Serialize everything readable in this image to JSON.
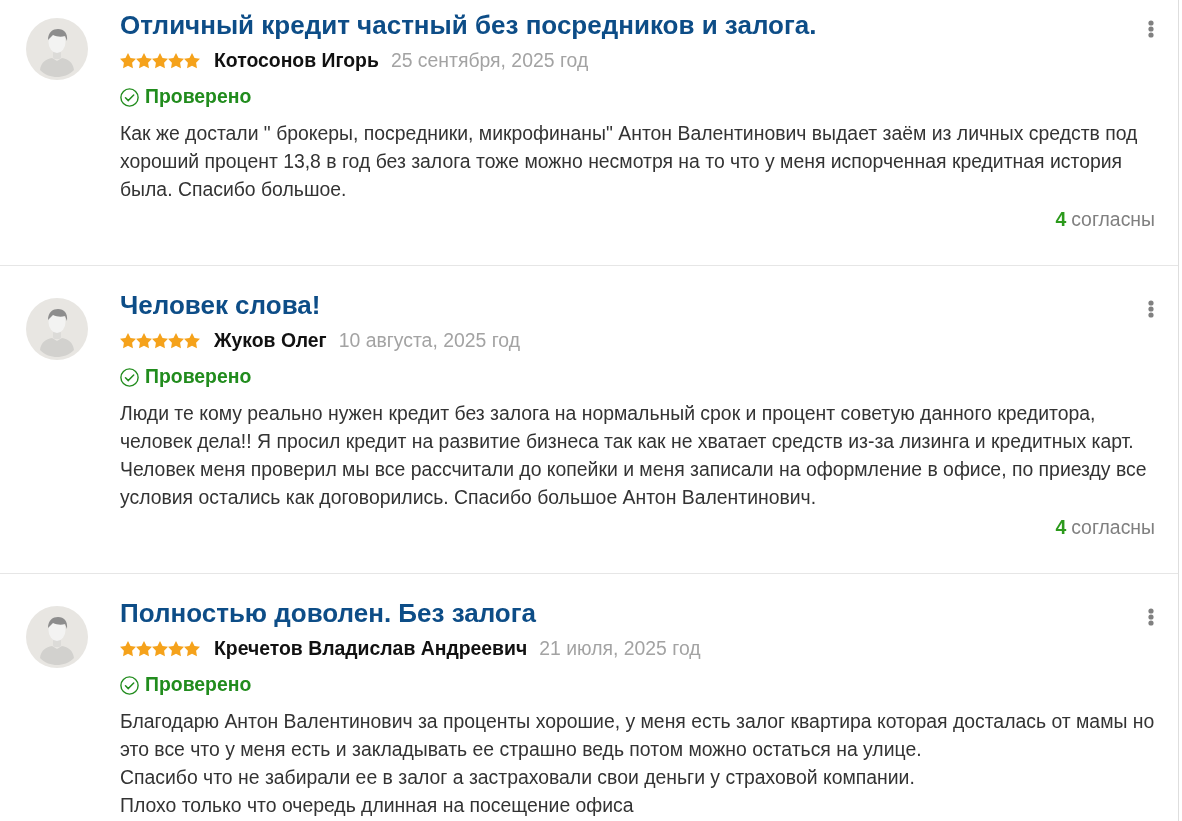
{
  "reviews": [
    {
      "title": "Отличный кредит частный без посредников и залога.",
      "stars": 5,
      "author": "Котосонов Игорь",
      "date": "25 сентября, 2025 год",
      "verified": true,
      "verified_label": "Проверено",
      "body": "Как же достали \" брокеры, посредники, микрофинаны\" Антон Валентинович выдает заём из личных средств под хороший процент 13,8 в год без залога тоже можно несмотря на то что у меня испорченная кредитная история была. Спасибо большое.",
      "agree_count": "4",
      "agree_label": "согласны"
    },
    {
      "title": "Человек слова!",
      "stars": 5,
      "author": "Жуков Олег",
      "date": "10 августа, 2025 год",
      "verified": true,
      "verified_label": "Проверено",
      "body": "Люди те кому реально нужен кредит без залога на нормальный срок и процент советую данного кредитора, человек дела!! Я просил кредит на развитие бизнеса так как не хватает средств из-за лизинга и кредитных карт. Человек меня проверил мы все рассчитали до копейки и меня записали на оформление в офисе, по приезду все условия остались как договорились. Спасибо большое Антон Валентинович.",
      "agree_count": "4",
      "agree_label": "согласны"
    },
    {
      "title": "Полностью доволен. Без залога",
      "stars": 5,
      "author": "Кречетов Владислав Андреевич",
      "date": "21 июля, 2025 год",
      "verified": true,
      "verified_label": "Проверено",
      "body": "Благодарю Антон Валентинович за проценты хорошие, у меня есть залог квартира которая досталась от мамы но это все что у меня есть и закладывать ее страшно ведь потом можно остаться на улице.\nСпасибо что не забирали ее в залог а застраховали свои деньги у страховой компании.\nПлохо только что очередь длинная на посещение офиса"
    }
  ]
}
